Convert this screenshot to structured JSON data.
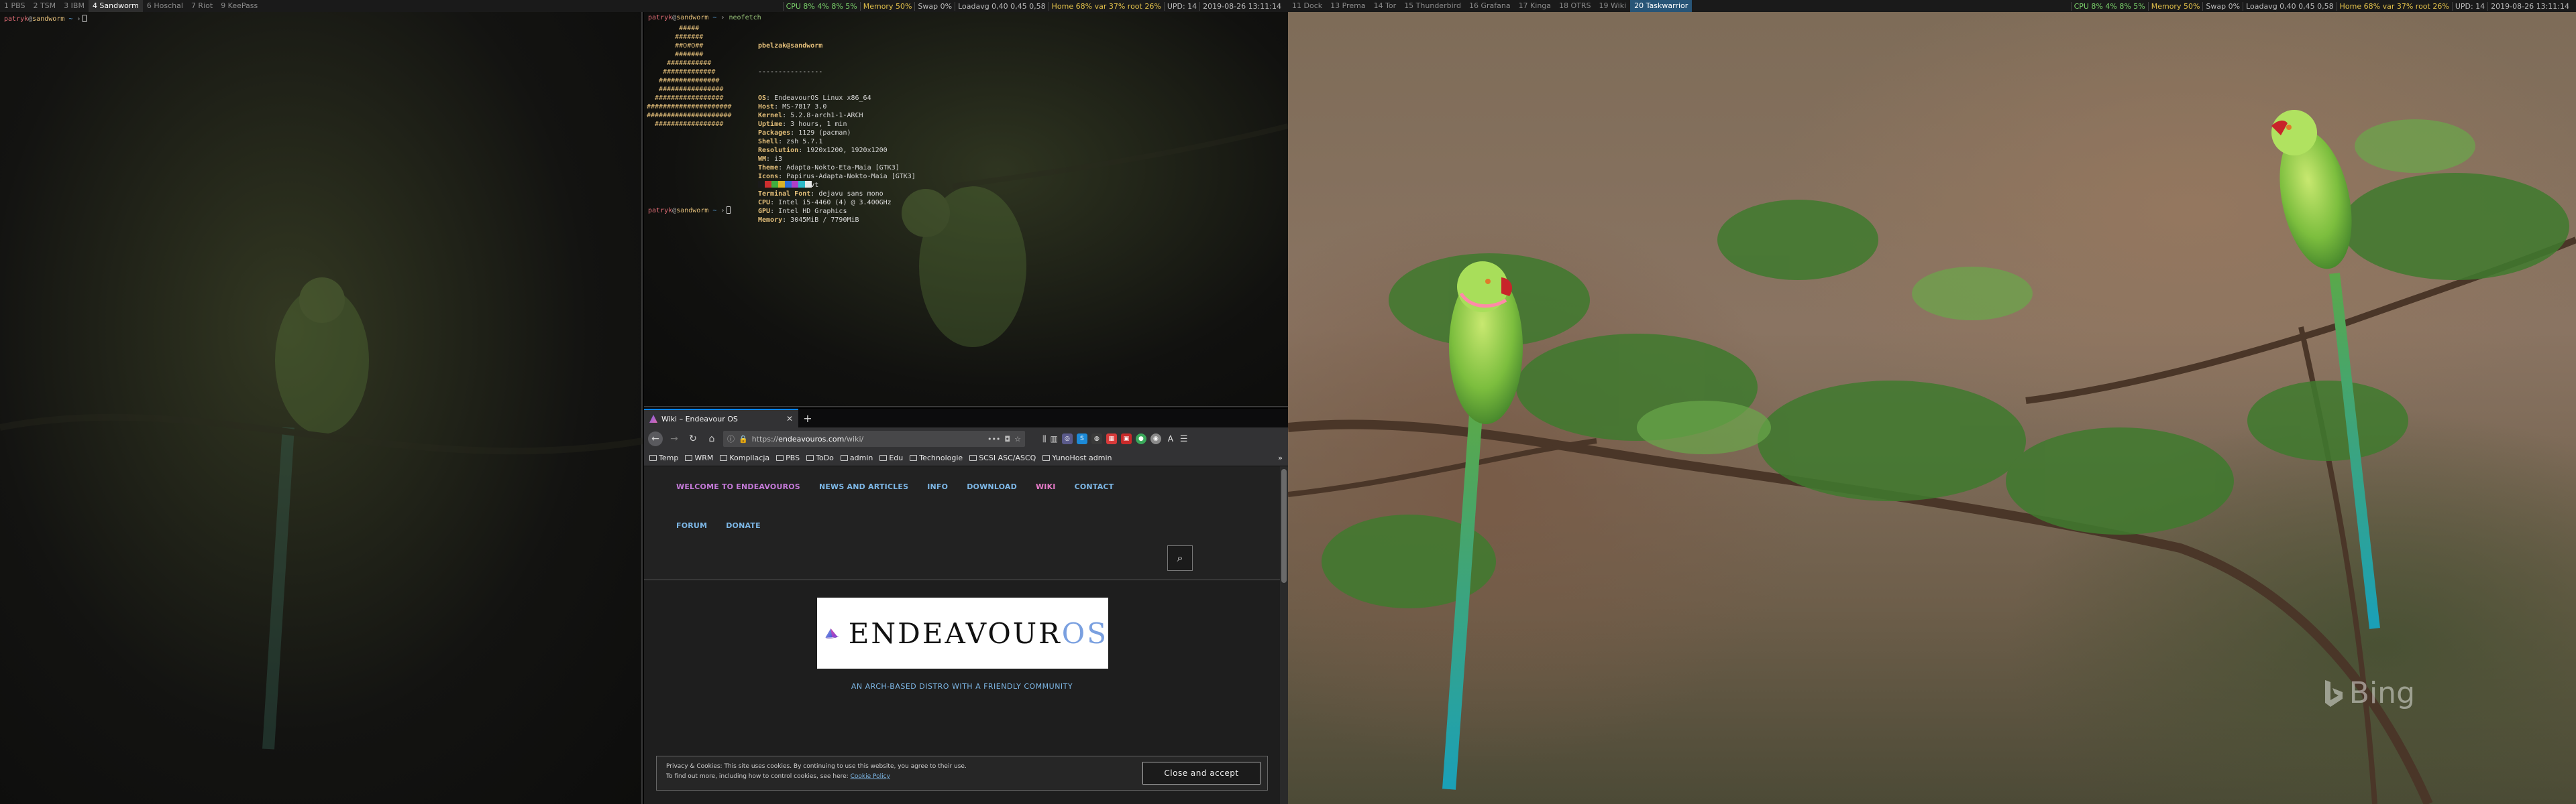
{
  "leftbar": {
    "workspaces": [
      {
        "label": "1 PBS",
        "state": "normal"
      },
      {
        "label": "2 TSM",
        "state": "normal"
      },
      {
        "label": "3 IBM",
        "state": "normal"
      },
      {
        "label": "4 Sandworm",
        "state": "active"
      },
      {
        "label": "6 Hoschal",
        "state": "normal"
      },
      {
        "label": "7 Riot",
        "state": "normal"
      },
      {
        "label": "9 KeePass",
        "state": "normal"
      }
    ],
    "status": [
      {
        "text": "CPU 8% 4% 8% 5%",
        "color": "g"
      },
      {
        "text": "Memory 50%",
        "color": "y"
      },
      {
        "text": "Swap 0%",
        "color": ""
      },
      {
        "text": "Loadavg 0,40 0,45 0,58",
        "color": ""
      },
      {
        "text": "Home 68% var 37% root 26%",
        "color": "y"
      },
      {
        "text": "UPD: 14",
        "color": ""
      },
      {
        "text": "2019-08-26 13:11:14",
        "color": ""
      }
    ]
  },
  "rightbar": {
    "workspaces": [
      {
        "label": "11 Dock",
        "state": "normal"
      },
      {
        "label": "13 Prema",
        "state": "normal"
      },
      {
        "label": "14 Tor",
        "state": "normal"
      },
      {
        "label": "15 Thunderbird",
        "state": "normal"
      },
      {
        "label": "16 Grafana",
        "state": "normal"
      },
      {
        "label": "17 Kinga",
        "state": "normal"
      },
      {
        "label": "18 OTRS",
        "state": "normal"
      },
      {
        "label": "19 Wiki",
        "state": "normal"
      },
      {
        "label": "20 Taskwarrior",
        "state": "focused"
      }
    ],
    "status": [
      {
        "text": "CPU 8% 4% 8% 5%",
        "color": "g"
      },
      {
        "text": "Memory 50%",
        "color": "y"
      },
      {
        "text": "Swap 0%",
        "color": ""
      },
      {
        "text": "Loadavg 0,40 0,45 0,58",
        "color": ""
      },
      {
        "text": "Home 68% var 37% root 26%",
        "color": "y"
      },
      {
        "text": "UPD: 14",
        "color": ""
      },
      {
        "text": "2019-08-26 13:11:14",
        "color": ""
      }
    ]
  },
  "terminal1": {
    "user": "patryk",
    "host": "sandworm",
    "path": "~"
  },
  "terminal2": {
    "user": "patryk",
    "host": "sandworm",
    "path": "~",
    "command": "neofetch",
    "logo": "        #####\n       #######\n       ##O#O##\n       #######\n     ###########\n    #############\n   ###############\n   ################\n  #################\n#####################\n#####################\n  #################",
    "header": "pbelzak@sandworm",
    "separator": "----------------",
    "info": [
      {
        "k": "OS",
        "v": "EndeavourOS Linux x86_64"
      },
      {
        "k": "Host",
        "v": "MS-7817 3.0"
      },
      {
        "k": "Kernel",
        "v": "5.2.8-arch1-1-ARCH"
      },
      {
        "k": "Uptime",
        "v": "3 hours, 1 min"
      },
      {
        "k": "Packages",
        "v": "1129 (pacman)"
      },
      {
        "k": "Shell",
        "v": "zsh 5.7.1"
      },
      {
        "k": "Resolution",
        "v": "1920x1200, 1920x1200"
      },
      {
        "k": "WM",
        "v": "i3"
      },
      {
        "k": "Theme",
        "v": "Adapta-Nokto-Eta-Maia [GTK3]"
      },
      {
        "k": "Icons",
        "v": "Papirus-Adapta-Nokto-Maia [GTK3]"
      },
      {
        "k": "Terminal",
        "v": "urxvt"
      },
      {
        "k": "Terminal Font",
        "v": "dejavu sans mono"
      },
      {
        "k": "CPU",
        "v": "Intel i5-4460 (4) @ 3.400GHz"
      },
      {
        "k": "GPU",
        "v": "Intel HD Graphics"
      },
      {
        "k": "Memory",
        "v": "3045MiB / 7790MiB"
      }
    ],
    "swatches": [
      "#1a1a1a",
      "#cc2e2e",
      "#3fae3f",
      "#d8b02a",
      "#2e6ed8",
      "#b03ec8",
      "#2eb8c8",
      "#e8e8e8"
    ]
  },
  "firefox": {
    "tab_title": "Wiki – Endeavour OS",
    "url_scheme": "https://",
    "url_host": "endeavouros.com",
    "url_path": "/wiki/",
    "bookmarks": [
      "Temp",
      "WRM",
      "Kompilacja",
      "PBS",
      "ToDo",
      "admin",
      "Edu",
      "Technologie",
      "SCSI ASC/ASCQ",
      "YunoHost admin"
    ],
    "page": {
      "nav_row1": [
        "WELCOME TO ENDEAVOUROS",
        "NEWS AND ARTICLES",
        "INFO",
        "DOWNLOAD",
        "WIKI",
        "CONTACT"
      ],
      "nav_row2": [
        "FORUM",
        "DONATE"
      ],
      "logo_main": "ENDEAVOUR",
      "logo_os": "OS",
      "tagline": "AN ARCH-BASED DISTRO WITH A FRIENDLY COMMUNITY",
      "cookie_line1": "Privacy & Cookies: This site uses cookies. By continuing to use this website, you agree to their use.",
      "cookie_line2": "To find out more, including how to control cookies, see here:",
      "cookie_link": "Cookie Policy",
      "cookie_button": "Close and accept"
    }
  },
  "wallpaper": {
    "watermark": "Bing"
  }
}
